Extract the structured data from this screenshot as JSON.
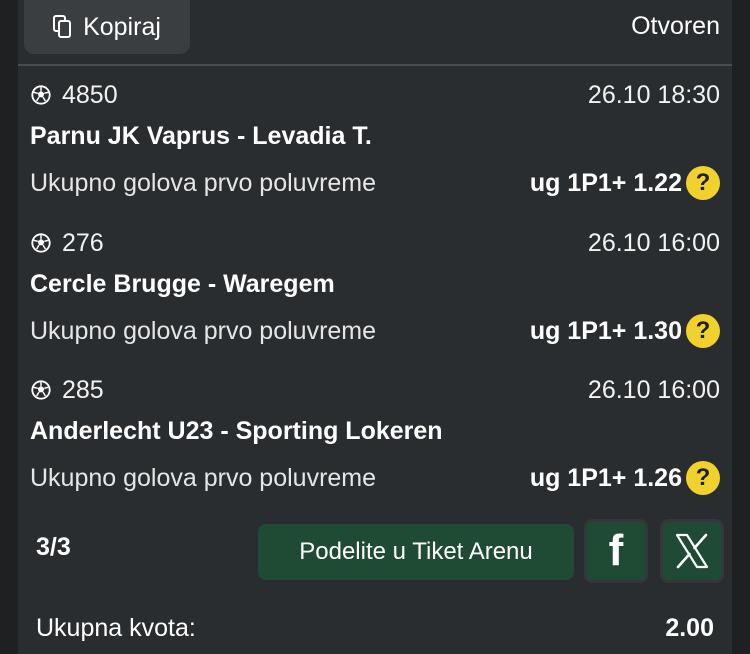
{
  "header": {
    "copy_label": "Kopiraj",
    "status": "Otvoren"
  },
  "matches": [
    {
      "id": "4850",
      "datetime": "26.10 18:30",
      "teams": "Parnu JK Vaprus - Levadia T.",
      "market": "Ukupno golova prvo poluvreme",
      "pick": "ug 1P1+ 1.22",
      "help": "?"
    },
    {
      "id": "276",
      "datetime": "26.10 16:00",
      "teams": "Cercle Brugge - Waregem",
      "market": "Ukupno golova prvo poluvreme",
      "pick": "ug 1P1+ 1.30",
      "help": "?"
    },
    {
      "id": "285",
      "datetime": "26.10 16:00",
      "teams": "Anderlecht U23 - Sporting Lokeren",
      "market": "Ukupno golova prvo poluvreme",
      "pick": "ug 1P1+ 1.26",
      "help": "?"
    }
  ],
  "footer": {
    "count": "3/3",
    "share_label": "Podelite u Tiket Arenu",
    "facebook_glyph": "f",
    "total_label": "Ukupna kvota:",
    "total_value": "2.00"
  },
  "colors": {
    "background": "#1e2022",
    "card": "#2a2d2f",
    "accent_green": "#1f4a34",
    "help_yellow": "#f0d12e"
  },
  "icons": [
    "copy-icon",
    "soccer-ball-icon",
    "help-icon",
    "facebook-icon",
    "x-icon"
  ]
}
